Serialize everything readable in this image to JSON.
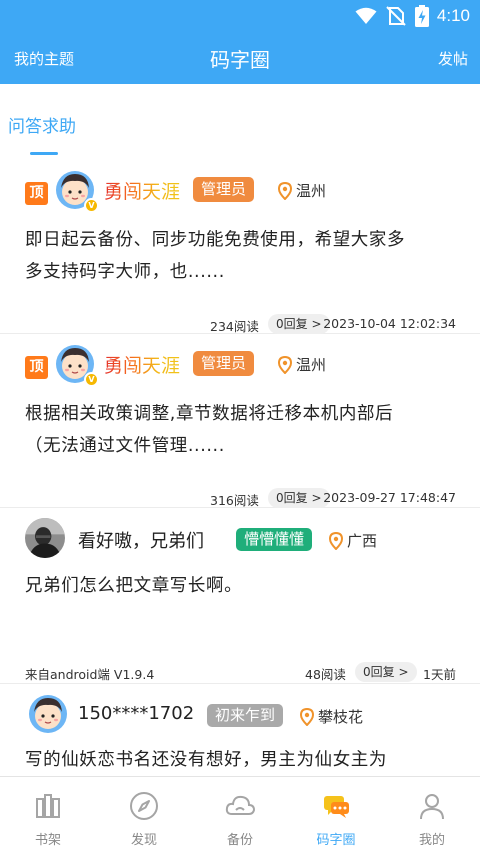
{
  "status": {
    "time": "4:10"
  },
  "header": {
    "left": "我的主题",
    "title": "码字圈",
    "right": "发帖"
  },
  "tab": {
    "label": "问答求助"
  },
  "posts": [
    {
      "pinned_label": "顶",
      "username": "勇闯天涯",
      "role": "管理员",
      "location": "温州",
      "content_line1": "即日起云备份、同步功能免费使用，希望大家多",
      "content_line2": "多支持码字大师，也......",
      "reads": "234阅读",
      "replies": "0回复 >",
      "date": "2023-10-04 12:02:34"
    },
    {
      "pinned_label": "顶",
      "username": "勇闯天涯",
      "role": "管理员",
      "location": "温州",
      "content_line1": "根据相关政策调整,章节数据将迁移本机内部后",
      "content_line2": "（无法通过文件管理......",
      "reads": "316阅读",
      "replies": "0回复 >",
      "date": "2023-09-27 17:48:47"
    },
    {
      "username": "看好嗷，兄弟们",
      "role": "懵懵懂懂",
      "location": "广西",
      "content_line1": "兄弟们怎么把文章写长啊。",
      "source": "来自android端 V1.9.4",
      "reads": "48阅读",
      "replies": "0回复 >",
      "date": "1天前"
    },
    {
      "username": "150****1702",
      "role": "初来乍到",
      "location": "攀枝花",
      "content_line1": "写的仙妖恋书名还没有想好，男主为仙女主为"
    }
  ],
  "nav": [
    {
      "label": "书架",
      "icon": "bookshelf-icon"
    },
    {
      "label": "发现",
      "icon": "compass-icon"
    },
    {
      "label": "备份",
      "icon": "cloud-backup-icon"
    },
    {
      "label": "码字圈",
      "icon": "chat-bubbles-icon",
      "active": true
    },
    {
      "label": "我的",
      "icon": "person-icon"
    }
  ],
  "colors": {
    "primary": "#3ea8f5",
    "pin": "#ff7a1a",
    "role_admin": "#f08b3f",
    "role_newbie_green": "#1fae7a",
    "role_newcomer_gray": "#a9a9a9",
    "location_pin": "#f0932b"
  }
}
